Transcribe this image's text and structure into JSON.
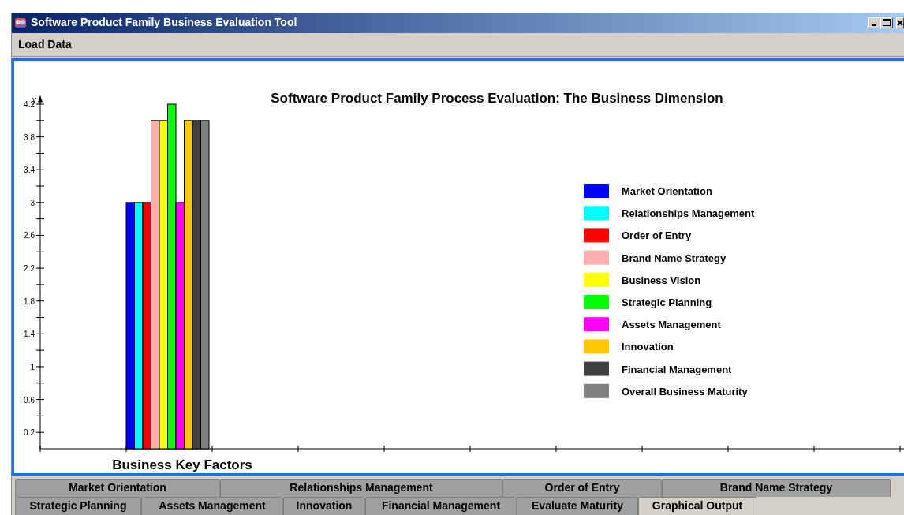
{
  "window": {
    "title": "Software Product Family Business Evaluation Tool"
  },
  "menu": [
    {
      "label": "Load Data"
    }
  ],
  "chart": {
    "chart_data": {
      "type": "bar",
      "title": "Software Product Family Process Evaluation: The Business Dimension",
      "xlabel": "Business Key Factors",
      "ylabel": "y",
      "ylim": [
        0,
        4.3
      ],
      "legend": true,
      "yticks": [
        0.2,
        0.6,
        1,
        1.4,
        1.8,
        2.2,
        2.6,
        3,
        3.4,
        3.8,
        4.2
      ],
      "series": [
        {
          "name": "Market Orientation",
          "color": "#0000ff",
          "values": [
            3
          ]
        },
        {
          "name": "Relationships Management",
          "color": "#00ffff",
          "values": [
            3
          ]
        },
        {
          "name": "Order of Entry",
          "color": "#ff0000",
          "values": [
            3
          ]
        },
        {
          "name": "Brand Name Strategy",
          "color": "#ffafaf",
          "values": [
            4
          ]
        },
        {
          "name": "Business Vision",
          "color": "#ffff00",
          "values": [
            4
          ]
        },
        {
          "name": "Strategic Planning",
          "color": "#00ff00",
          "values": [
            4.2
          ]
        },
        {
          "name": "Assets Management",
          "color": "#ff00ff",
          "values": [
            3
          ]
        },
        {
          "name": "Innovation",
          "color": "#ffc800",
          "values": [
            4
          ]
        },
        {
          "name": "Financial Management",
          "color": "#404040",
          "values": [
            4
          ]
        },
        {
          "name": "Overall Business Maturity",
          "color": "#808080",
          "values": [
            4
          ]
        }
      ]
    }
  },
  "tab_strips": [
    {
      "tabs": [
        {
          "label": "Market Orientation",
          "selected": false
        },
        {
          "label": "Relationships Management",
          "selected": false
        },
        {
          "label": "Order of Entry",
          "selected": false
        },
        {
          "label": "Brand Name Strategy",
          "selected": false
        }
      ]
    },
    {
      "tabs": [
        {
          "label": "Strategic Planning",
          "selected": false
        },
        {
          "label": "Assets Management",
          "selected": false
        },
        {
          "label": "Innovation",
          "selected": false
        },
        {
          "label": "Financial Management",
          "selected": false
        },
        {
          "label": "Evaluate Maturity",
          "selected": false
        },
        {
          "label": "Graphical Output",
          "selected": true
        }
      ]
    }
  ]
}
